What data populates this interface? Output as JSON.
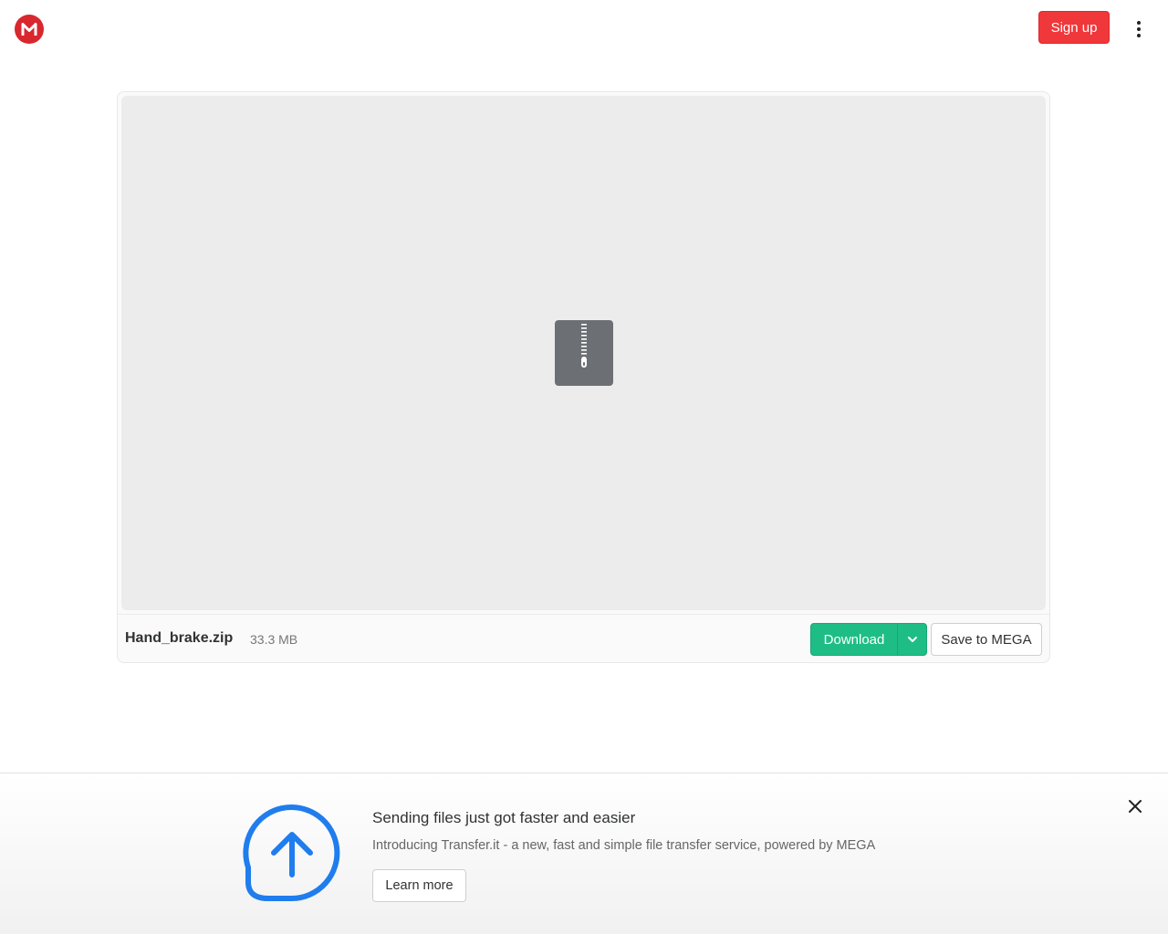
{
  "header": {
    "signup_label": "Sign up"
  },
  "file": {
    "name": "Hand_brake.zip",
    "size": "33.3 MB",
    "download_label": "Download",
    "save_label": "Save to MEGA"
  },
  "banner": {
    "title": "Sending files just got faster and easier",
    "description": "Introducing Transfer.it - a new, fast and simple file transfer service, powered by MEGA",
    "learn_more_label": "Learn more"
  },
  "colors": {
    "brand_red": "#d9272e",
    "signup_red": "#f0373a",
    "download_green": "#1fbd86",
    "transfer_blue": "#1f7ded"
  },
  "icons": {
    "logo": "mega-logo-icon",
    "menu": "more-vertical-icon",
    "file_type": "zip-file-icon",
    "dropdown": "chevron-down-icon",
    "banner": "upload-arrow-circle-icon",
    "close": "close-icon"
  }
}
